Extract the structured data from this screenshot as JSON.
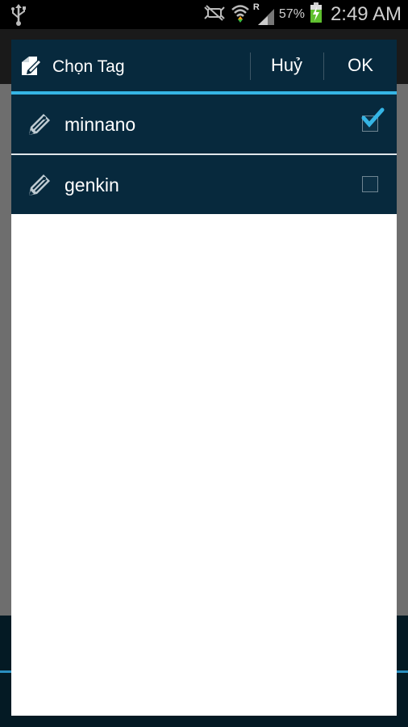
{
  "status_bar": {
    "battery_percent": "57%",
    "time": "2:49 AM",
    "roaming": "R",
    "icons": [
      "usb-icon",
      "mute-icon",
      "wifi-icon",
      "signal-icon",
      "battery-charging-icon"
    ]
  },
  "dialog": {
    "title": "Chọn Tag",
    "cancel_label": "Huỷ",
    "ok_label": "OK",
    "icon": "tag-edit-icon",
    "items": [
      {
        "label": "minnano",
        "checked": true,
        "icon": "tag-icon"
      },
      {
        "label": "genkin",
        "checked": false,
        "icon": "tag-icon"
      }
    ]
  },
  "colors": {
    "header_bg": "#07293d",
    "accent": "#35b5e5",
    "row_bg": "#07293d"
  }
}
